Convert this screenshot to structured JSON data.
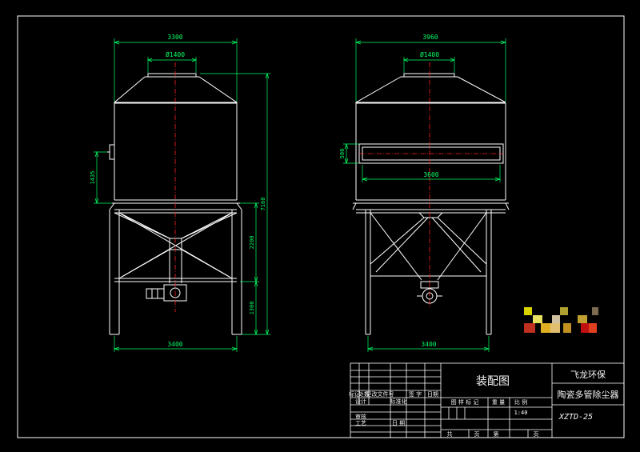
{
  "front_view": {
    "dims": {
      "top_width": "3300",
      "outlet_diameter": "Ø1400",
      "total_height": "7160",
      "inlet_height": "1435",
      "hopper_height": "2200",
      "leg_height": "1300",
      "base_width": "3400"
    }
  },
  "side_view": {
    "dims": {
      "top_width": "3960",
      "outlet_diameter": "Ø1400",
      "inlet_height": "500",
      "inlet_width": "3600",
      "base_width": "3400"
    }
  },
  "title_block": {
    "drawing_name": "装配图",
    "company": "飞龙环保",
    "product": "陶瓷多管除尘器",
    "code": "XZTD-25",
    "scale_value": "1:40",
    "headers": {
      "mark": "标记",
      "count": "处数",
      "change_doc": "更改文件号",
      "signature": "签 字",
      "date": "日期",
      "design": "设计",
      "standardize": "标准化",
      "review": "审核",
      "process": "工艺",
      "date2": "日 期",
      "stage_mark": "图 样 标 记",
      "weight": "重 量",
      "scale": "比 例",
      "total": "共",
      "sheets": "页",
      "sheet_no": "第",
      "pages": "页"
    }
  },
  "colors": {
    "background": "#000000",
    "outline": "#ffffff",
    "dimension": "#00ff66",
    "centerline": "#ff2020",
    "frame": "#ffffff",
    "hidden": "#00c8ff"
  }
}
